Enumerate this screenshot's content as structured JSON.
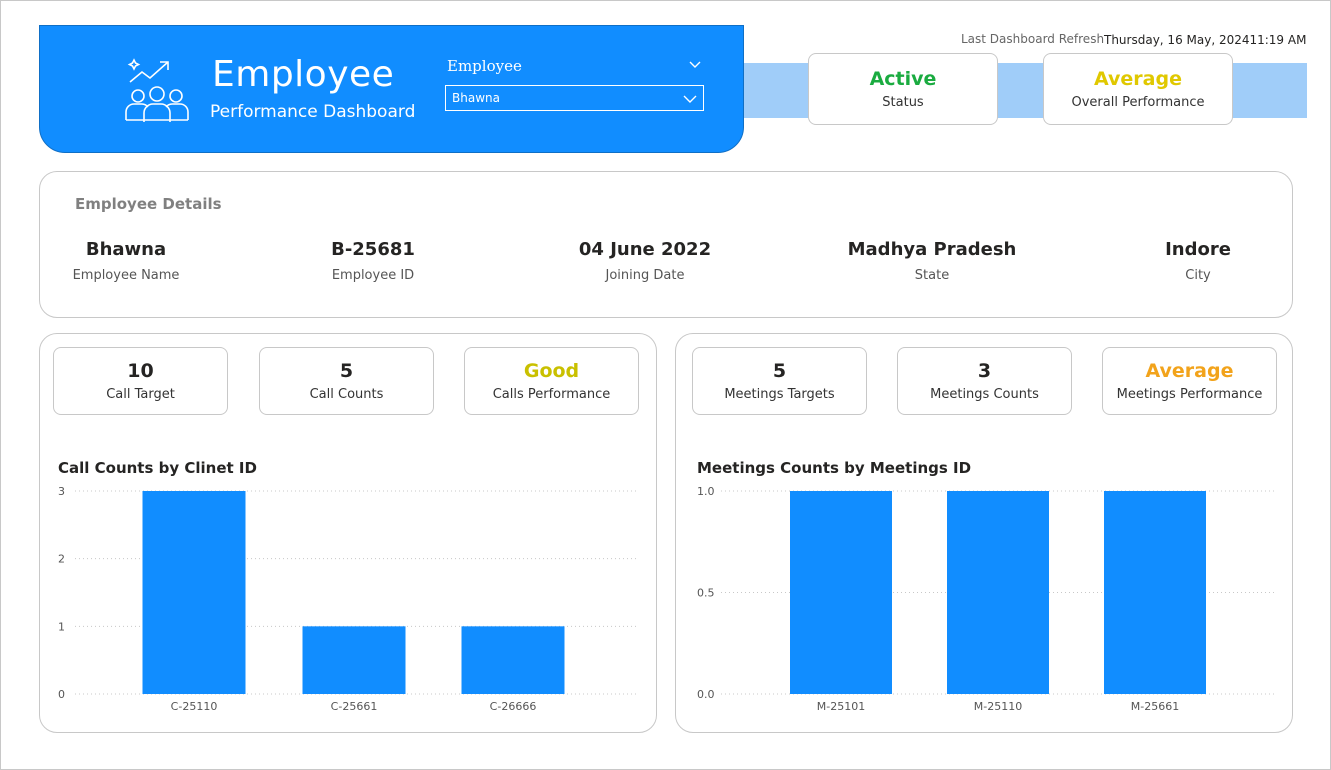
{
  "header": {
    "title": "Employee",
    "subtitle": "Performance Dashboard",
    "slicer_label": "Employee",
    "slicer_value": "Bhawna",
    "refresh_label": "Last Dashboard Refresh",
    "refresh_value": "Thursday, 16 May, 202411:19 AM"
  },
  "status_cards": [
    {
      "value": "Active",
      "label": "Status",
      "color": "#1aab40"
    },
    {
      "value": "Average",
      "label": "Overall Performance",
      "color": "#e0c800"
    }
  ],
  "employee_details": {
    "title": "Employee Details",
    "items": [
      {
        "value": "Bhawna",
        "label": "Employee Name"
      },
      {
        "value": "B-25681",
        "label": "Employee ID"
      },
      {
        "value": "04 June 2022",
        "label": "Joining Date"
      },
      {
        "value": "Madhya Pradesh",
        "label": "State"
      },
      {
        "value": "Indore",
        "label": "City"
      }
    ]
  },
  "calls_panel": {
    "kpis": [
      {
        "value": "10",
        "label": "Call Target",
        "color": "#252423"
      },
      {
        "value": "5",
        "label": "Call Counts",
        "color": "#252423"
      },
      {
        "value": "Good",
        "label": "Calls Performance",
        "color": "#c9c000"
      }
    ],
    "chart_title": "Call Counts by Clinet ID"
  },
  "meetings_panel": {
    "kpis": [
      {
        "value": "5",
        "label": "Meetings Targets",
        "color": "#252423"
      },
      {
        "value": "3",
        "label": "Meetings Counts",
        "color": "#252423"
      },
      {
        "value": "Average",
        "label": "Meetings Performance",
        "color": "#f2a31b"
      }
    ],
    "chart_title": "Meetings Counts by Meetings ID"
  },
  "colors": {
    "accent": "#118dff",
    "band": "#a0cdf9"
  },
  "chart_data": [
    {
      "type": "bar",
      "title": "Call Counts by Clinet ID",
      "categories": [
        "C-25110",
        "C-25661",
        "C-26666"
      ],
      "values": [
        3,
        1,
        1
      ],
      "ylim": [
        0,
        3
      ],
      "yticks": [
        "0",
        "1",
        "2",
        "3"
      ],
      "grid": true
    },
    {
      "type": "bar",
      "title": "Meetings Counts by Meetings ID",
      "categories": [
        "M-25101",
        "M-25110",
        "M-25661"
      ],
      "values": [
        1,
        1,
        1
      ],
      "ylim": [
        0,
        1
      ],
      "yticks": [
        "0.0",
        "0.5",
        "1.0"
      ],
      "grid": true
    }
  ]
}
